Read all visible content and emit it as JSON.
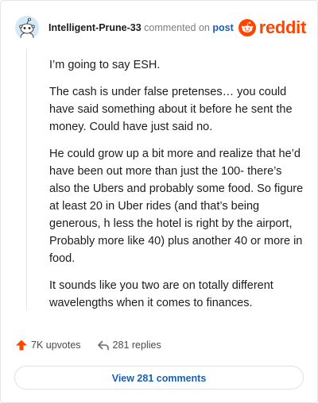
{
  "comment": {
    "username": "Intelligent-Prune-33",
    "action_text": "commented on",
    "post_link": "post",
    "brand_text": "reddit",
    "paragraphs": [
      "I’m going to say ESH.",
      "The cash is under false pretenses… you could have said something about it before he sent the money. Could have just said no.",
      "He could grow up a bit more and realize that he’d have been out more than just the 100- there’s also the Ubers and probably some food. So figure at least 20 in Uber rides (and that’s being generous, h less the hotel is right by the airport, Probably more like 40) plus another 40 or more in food.",
      "It sounds like you two are on totally different wavelengths when it comes to finances."
    ]
  },
  "actions": {
    "upvotes": "7K upvotes",
    "replies": "281 replies",
    "view_comments": "View 281 comments"
  },
  "colors": {
    "brand": "#ff4500",
    "link": "#1a5fb4",
    "text": "#1c1c1c",
    "muted": "#7c7c7c",
    "avatar_bg": "#d3e9f7"
  },
  "icons": {
    "avatar": "snoo-avatar-icon",
    "brand": "reddit-logo-icon",
    "upvote": "upvote-arrow-icon",
    "reply": "reply-arrow-icon"
  }
}
